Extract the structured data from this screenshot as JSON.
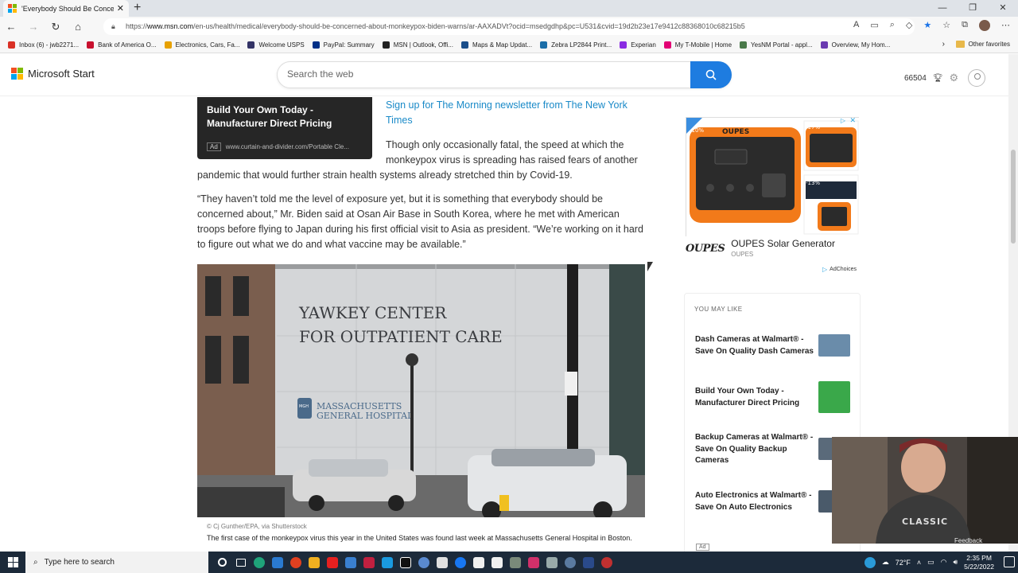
{
  "browser": {
    "tab_title": "'Everybody Should Be Concerned'",
    "url_prefix": "https://",
    "url_domain": "www.msn.com",
    "url_rest": "/en-us/health/medical/everybody-should-be-concerned-about-monkeypox-biden-warns/ar-AAXADVt?ocid=msedgdhp&pc=U531&cvid=19d2b23e17e9412c88368010c68215b5",
    "favorites": [
      {
        "label": "Inbox (6) - jwb2271...",
        "color": "#d93025"
      },
      {
        "label": "Bank of America  O...",
        "color": "#c8102e"
      },
      {
        "label": "Electronics, Cars, Fa...",
        "color": "#e7a100"
      },
      {
        "label": "Welcome  USPS",
        "color": "#333366"
      },
      {
        "label": "PayPal: Summary",
        "color": "#003087"
      },
      {
        "label": "MSN | Outlook, Offi...",
        "color": "#222222"
      },
      {
        "label": "Maps & Map Updat...",
        "color": "#1a4e8a"
      },
      {
        "label": "Zebra LP2844 Print...",
        "color": "#1a6ea8"
      },
      {
        "label": "Experian",
        "color": "#8a2be2"
      },
      {
        "label": "My T-Mobile | Home",
        "color": "#e20074"
      },
      {
        "label": "YesNM Portal - appl...",
        "color": "#4a7a4a"
      },
      {
        "label": "Overview, My Hom...",
        "color": "#6a3ab0"
      }
    ],
    "other_favorites": "Other favorites"
  },
  "header": {
    "logo_text": "Microsoft Start",
    "search_placeholder": "Search the web",
    "points": "66504"
  },
  "article": {
    "ad_title": "Build Your Own Today - Manufacturer Direct Pricing",
    "ad_tag": "Ad",
    "ad_url": "www.curtain-and-divider.com/Portable Cle...",
    "newsletter_link": "Sign up for The Morning newsletter from The New York Times",
    "para1_a": "Though only occasionally fatal, the speed at which the monkeypox virus is spreading has raised fears of another",
    "para1_b": "pandemic that would further strain health systems already stretched thin by Covid-19.",
    "para2": "“They haven’t told me the level of exposure yet, but it is something that everybody should be concerned about,” Mr. Biden said at Osan Air Base in South Korea, where he met with American troops before flying to Japan during his first official visit to Asia as president. “We’re working on it hard to figure out what we do and what vaccine may be available.”",
    "photo_sign1": "YAWKEY CENTER",
    "photo_sign2": "FOR OUTPATIENT CARE",
    "photo_sign3": "MASSACHUSETTS",
    "photo_sign4": "GENERAL HOSPITAL",
    "photo_logo": "MGH",
    "photo_credit": "© Cj Gunther/EPA, via Shutterstock",
    "photo_caption": "The first case of the monkeypox virus this year in the United States was found last week at Massachusetts General Hospital in Boston."
  },
  "sidebar": {
    "ad_brand_logo": "OUPES",
    "ad_title": "OUPES Solar Generator",
    "ad_sub": "OUPES",
    "ad_discounts": [
      "-10%",
      "-17%",
      "-13%"
    ],
    "adchoices": "AdChoices",
    "you_may_like": "YOU MAY LIKE",
    "items": [
      {
        "title": "Dash Cameras at Walmart® - Save On Quality Dash Cameras",
        "color": "#6a8caa"
      },
      {
        "title": "Build Your Own Today - Manufacturer Direct Pricing",
        "color": "#3aa84a"
      },
      {
        "title": "Backup Cameras at Walmart® - Save On Quality Backup Cameras",
        "color": "#5a6a7a"
      },
      {
        "title": "Auto Electronics at Walmart® - Save On Auto Electronics",
        "color": "#4a5a6a"
      }
    ],
    "ad_small": "Ad",
    "feedback": "Feedback"
  },
  "taskbar": {
    "search_placeholder": "Type here to search",
    "temperature": "72°F",
    "time": "2:35 PM",
    "date": "5/22/2022"
  }
}
